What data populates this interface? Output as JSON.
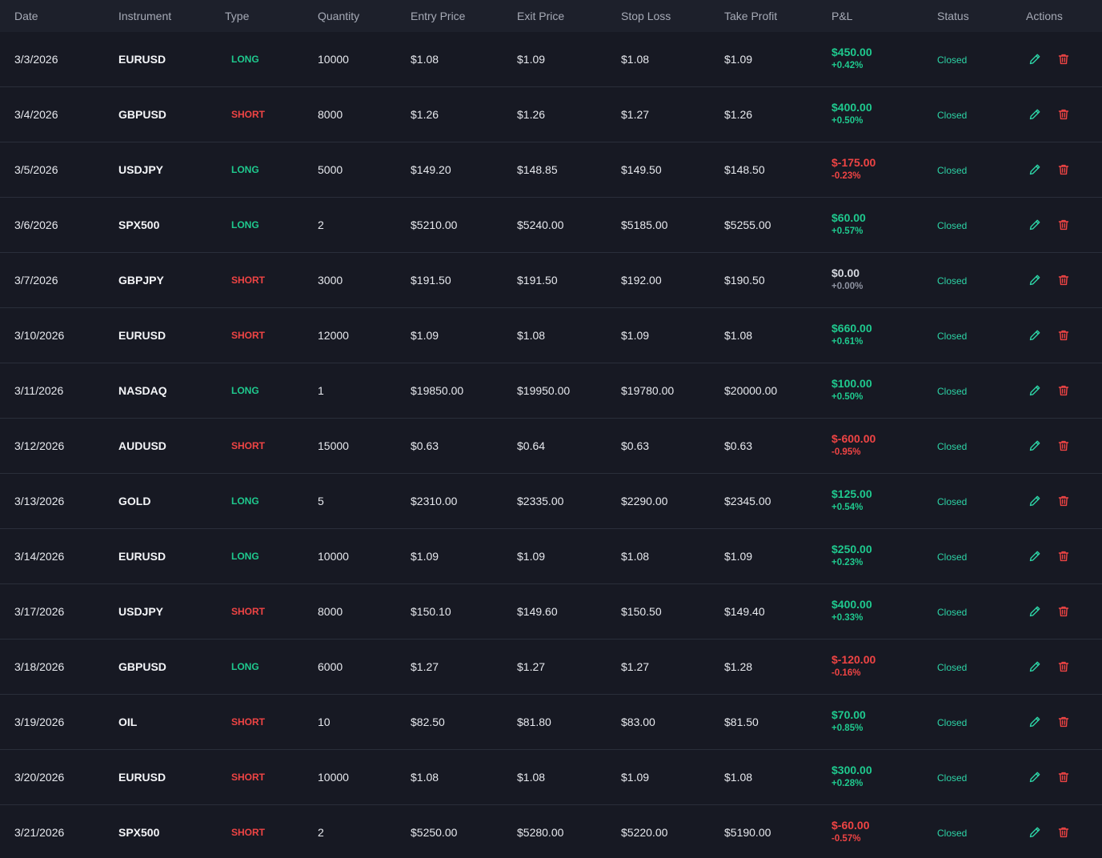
{
  "columns": {
    "date": "Date",
    "instrument": "Instrument",
    "type": "Type",
    "quantity": "Quantity",
    "entry": "Entry Price",
    "exit": "Exit Price",
    "stop": "Stop Loss",
    "take": "Take Profit",
    "pnl": "P&L",
    "status": "Status",
    "actions": "Actions"
  },
  "colors": {
    "positive": "#1fc98e",
    "negative": "#ef4444",
    "status": "#2dd4a6"
  },
  "rows": [
    {
      "date": "3/3/2026",
      "instrument": "EURUSD",
      "type": "LONG",
      "quantity": "10000",
      "entry": "$1.08",
      "exit": "$1.09",
      "stop": "$1.08",
      "take": "$1.09",
      "pnl": "$450.00",
      "pnl_pct": "+0.42%",
      "pnl_sign": "pos",
      "status": "Closed",
      "actions": [
        "pencil-icon",
        "trash-icon"
      ]
    },
    {
      "date": "3/4/2026",
      "instrument": "GBPUSD",
      "type": "SHORT",
      "quantity": "8000",
      "entry": "$1.26",
      "exit": "$1.26",
      "stop": "$1.27",
      "take": "$1.26",
      "pnl": "$400.00",
      "pnl_pct": "+0.50%",
      "pnl_sign": "pos",
      "status": "Closed",
      "actions": [
        "pencil-icon",
        "trash-icon"
      ]
    },
    {
      "date": "3/5/2026",
      "instrument": "USDJPY",
      "type": "LONG",
      "quantity": "5000",
      "entry": "$149.20",
      "exit": "$148.85",
      "stop": "$149.50",
      "take": "$148.50",
      "pnl": "$-175.00",
      "pnl_pct": "-0.23%",
      "pnl_sign": "neg",
      "status": "Closed",
      "actions": [
        "pencil-icon",
        "trash-icon"
      ]
    },
    {
      "date": "3/6/2026",
      "instrument": "SPX500",
      "type": "LONG",
      "quantity": "2",
      "entry": "$5210.00",
      "exit": "$5240.00",
      "stop": "$5185.00",
      "take": "$5255.00",
      "pnl": "$60.00",
      "pnl_pct": "+0.57%",
      "pnl_sign": "pos",
      "status": "Closed",
      "actions": [
        "pencil-icon",
        "trash-icon"
      ]
    },
    {
      "date": "3/7/2026",
      "instrument": "GBPJPY",
      "type": "SHORT",
      "quantity": "3000",
      "entry": "$191.50",
      "exit": "$191.50",
      "stop": "$192.00",
      "take": "$190.50",
      "pnl": "$0.00",
      "pnl_pct": "+0.00%",
      "pnl_sign": "zero",
      "status": "Closed",
      "actions": [
        "pencil-icon",
        "trash-icon"
      ]
    },
    {
      "date": "3/10/2026",
      "instrument": "EURUSD",
      "type": "SHORT",
      "quantity": "12000",
      "entry": "$1.09",
      "exit": "$1.08",
      "stop": "$1.09",
      "take": "$1.08",
      "pnl": "$660.00",
      "pnl_pct": "+0.61%",
      "pnl_sign": "pos",
      "status": "Closed",
      "actions": [
        "pencil-icon",
        "trash-icon"
      ]
    },
    {
      "date": "3/11/2026",
      "instrument": "NASDAQ",
      "type": "LONG",
      "quantity": "1",
      "entry": "$19850.00",
      "exit": "$19950.00",
      "stop": "$19780.00",
      "take": "$20000.00",
      "pnl": "$100.00",
      "pnl_pct": "+0.50%",
      "pnl_sign": "pos",
      "status": "Closed",
      "actions": [
        "pencil-icon",
        "trash-icon"
      ]
    },
    {
      "date": "3/12/2026",
      "instrument": "AUDUSD",
      "type": "SHORT",
      "quantity": "15000",
      "entry": "$0.63",
      "exit": "$0.64",
      "stop": "$0.63",
      "take": "$0.63",
      "pnl": "$-600.00",
      "pnl_pct": "-0.95%",
      "pnl_sign": "neg",
      "status": "Closed",
      "actions": [
        "pencil-icon",
        "trash-icon"
      ]
    },
    {
      "date": "3/13/2026",
      "instrument": "GOLD",
      "type": "LONG",
      "quantity": "5",
      "entry": "$2310.00",
      "exit": "$2335.00",
      "stop": "$2290.00",
      "take": "$2345.00",
      "pnl": "$125.00",
      "pnl_pct": "+0.54%",
      "pnl_sign": "pos",
      "status": "Closed",
      "actions": [
        "pencil-icon",
        "trash-icon"
      ]
    },
    {
      "date": "3/14/2026",
      "instrument": "EURUSD",
      "type": "LONG",
      "quantity": "10000",
      "entry": "$1.09",
      "exit": "$1.09",
      "stop": "$1.08",
      "take": "$1.09",
      "pnl": "$250.00",
      "pnl_pct": "+0.23%",
      "pnl_sign": "pos",
      "status": "Closed",
      "actions": [
        "pencil-icon",
        "trash-icon"
      ]
    },
    {
      "date": "3/17/2026",
      "instrument": "USDJPY",
      "type": "SHORT",
      "quantity": "8000",
      "entry": "$150.10",
      "exit": "$149.60",
      "stop": "$150.50",
      "take": "$149.40",
      "pnl": "$400.00",
      "pnl_pct": "+0.33%",
      "pnl_sign": "pos",
      "status": "Closed",
      "actions": [
        "pencil-icon",
        "trash-icon"
      ]
    },
    {
      "date": "3/18/2026",
      "instrument": "GBPUSD",
      "type": "LONG",
      "quantity": "6000",
      "entry": "$1.27",
      "exit": "$1.27",
      "stop": "$1.27",
      "take": "$1.28",
      "pnl": "$-120.00",
      "pnl_pct": "-0.16%",
      "pnl_sign": "neg",
      "status": "Closed",
      "actions": [
        "pencil-icon",
        "trash-icon"
      ]
    },
    {
      "date": "3/19/2026",
      "instrument": "OIL",
      "type": "SHORT",
      "quantity": "10",
      "entry": "$82.50",
      "exit": "$81.80",
      "stop": "$83.00",
      "take": "$81.50",
      "pnl": "$70.00",
      "pnl_pct": "+0.85%",
      "pnl_sign": "pos",
      "status": "Closed",
      "actions": [
        "pencil-icon",
        "trash-icon"
      ]
    },
    {
      "date": "3/20/2026",
      "instrument": "EURUSD",
      "type": "SHORT",
      "quantity": "10000",
      "entry": "$1.08",
      "exit": "$1.08",
      "stop": "$1.09",
      "take": "$1.08",
      "pnl": "$300.00",
      "pnl_pct": "+0.28%",
      "pnl_sign": "pos",
      "status": "Closed",
      "actions": [
        "pencil-icon",
        "trash-icon"
      ]
    },
    {
      "date": "3/21/2026",
      "instrument": "SPX500",
      "type": "SHORT",
      "quantity": "2",
      "entry": "$5250.00",
      "exit": "$5280.00",
      "stop": "$5220.00",
      "take": "$5190.00",
      "pnl": "$-60.00",
      "pnl_pct": "-0.57%",
      "pnl_sign": "neg",
      "status": "Closed",
      "actions": [
        "pencil-icon",
        "trash-icon"
      ]
    }
  ]
}
